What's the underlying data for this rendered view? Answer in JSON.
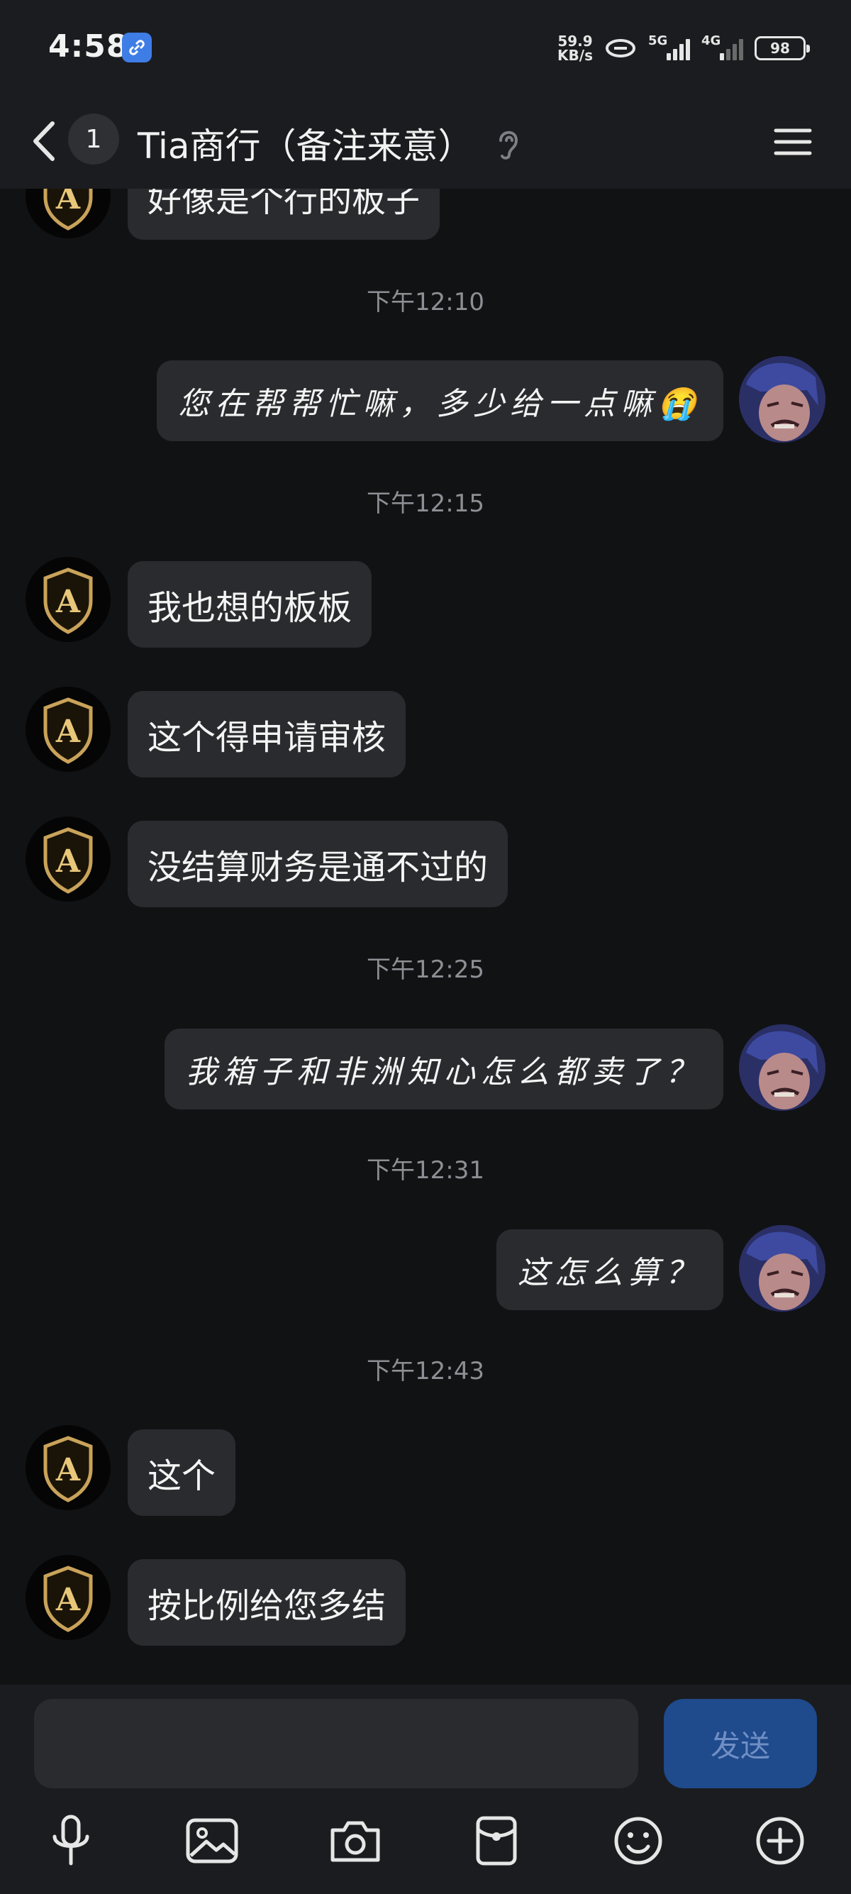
{
  "status_bar": {
    "time": "4:58",
    "net_speed_value": "59.9",
    "net_speed_unit": "KB/s",
    "sig1_label": "5G",
    "sig2_label": "4G",
    "battery": "98"
  },
  "header": {
    "unread_count": "1",
    "title": "Tia商行（备注来意）"
  },
  "messages": [
    {
      "type": "in",
      "text": "好像是个行的板子"
    },
    {
      "type": "time",
      "text": "下午12:10"
    },
    {
      "type": "out",
      "text": "您在帮帮忙嘛，多少给一点嘛😭"
    },
    {
      "type": "time",
      "text": "下午12:15"
    },
    {
      "type": "in",
      "text": "我也想的板板"
    },
    {
      "type": "in",
      "text": "这个得申请审核"
    },
    {
      "type": "in",
      "text": "没结算财务是通不过的"
    },
    {
      "type": "time",
      "text": "下午12:25"
    },
    {
      "type": "out",
      "text": "我箱子和非洲知心怎么都卖了？"
    },
    {
      "type": "time",
      "text": "下午12:31"
    },
    {
      "type": "out",
      "text": "这怎么算？"
    },
    {
      "type": "time",
      "text": "下午12:43"
    },
    {
      "type": "in",
      "text": "这个"
    },
    {
      "type": "in",
      "text": "按比例给您多结"
    }
  ],
  "composer": {
    "input_value": "",
    "send_label": "发送"
  },
  "toolbar": [
    "mic-icon",
    "image-icon",
    "camera-icon",
    "red-packet-icon",
    "emoji-icon",
    "plus-icon"
  ],
  "colors": {
    "background": "#111214",
    "bar": "#1b1c1f",
    "bubble": "#2a2b2e",
    "send_button": "#1f4a8c"
  }
}
